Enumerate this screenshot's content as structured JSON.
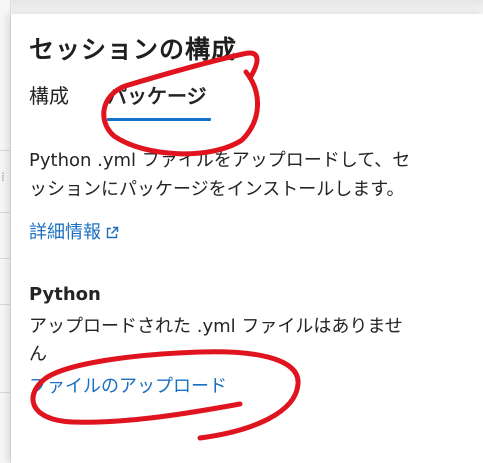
{
  "panel": {
    "title": "セッションの構成",
    "tabs": [
      {
        "label": "構成",
        "active": false
      },
      {
        "label": "パッケージ",
        "active": true
      }
    ],
    "description_lines": [
      "Python .yml ファイルをアップロードして、セ",
      "ッションにパッケージをインストールします。"
    ],
    "learn_more": {
      "label": "詳細情報",
      "icon": "external-link-icon"
    },
    "python_section": {
      "heading": "Python",
      "empty_lines": [
        "アップロードされた .yml ファイルはありませ",
        "ん"
      ],
      "upload_link": "ファイルのアップロード"
    }
  },
  "colors": {
    "accent": "#1470c8",
    "link": "#1a6fc1",
    "annotation": "#e0141e"
  }
}
